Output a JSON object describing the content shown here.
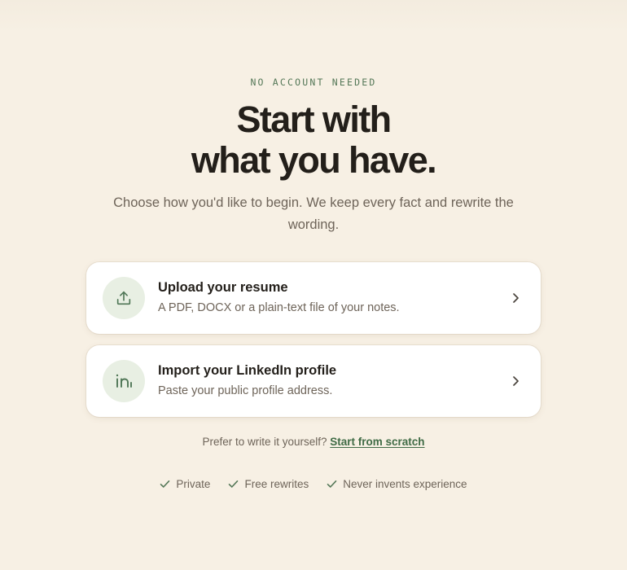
{
  "hero": {
    "eyebrow": "NO ACCOUNT NEEDED",
    "headline_line1": "Start with",
    "headline_line2": "what you have.",
    "subtitle": "Choose how you'd like to begin. We keep every fact and rewrite the wording."
  },
  "options": [
    {
      "icon": "upload-icon",
      "title": "Upload your resume",
      "description": "A PDF, DOCX or a plain-text file of your notes."
    },
    {
      "icon": "linkedin-icon",
      "title": "Import your LinkedIn profile",
      "description": "Paste your public profile address."
    }
  ],
  "alternative": {
    "prompt": "Prefer to write it yourself?",
    "link_label": "Start from scratch"
  },
  "features": [
    "Private",
    "Free rewrites",
    "Never invents experience"
  ],
  "colors": {
    "background": "#f7f0e4",
    "accent": "#3f6b45",
    "icon_bg": "#e8efe3",
    "card": "#ffffff"
  }
}
